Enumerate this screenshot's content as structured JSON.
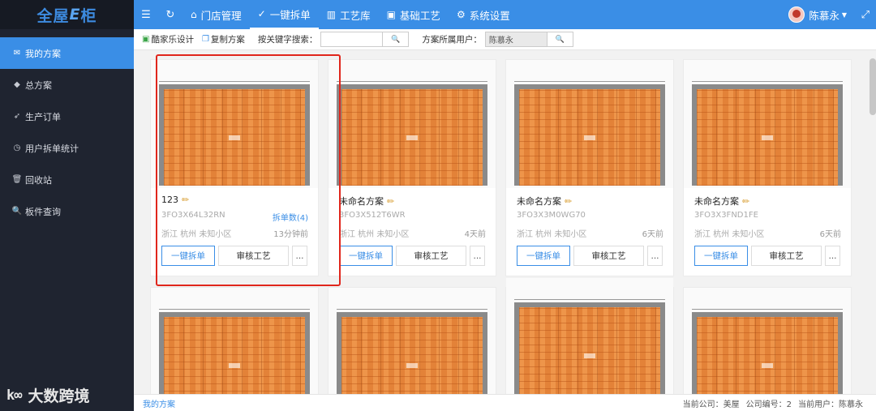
{
  "app": {
    "logo_main": "全屋",
    "logo_e": "E",
    "logo_tail": "柜"
  },
  "sidebar": {
    "items": [
      {
        "label": "我的方案",
        "icon": "✉",
        "active": true
      },
      {
        "label": "总方案",
        "icon": "◆",
        "active": false
      },
      {
        "label": "生产订单",
        "icon": "➶",
        "active": false
      },
      {
        "label": "用户拆单统计",
        "icon": "◷",
        "active": false
      },
      {
        "label": "回收站",
        "icon": "🗑",
        "active": false
      },
      {
        "label": "板件查询",
        "icon": "🔍",
        "active": false
      }
    ],
    "watermark": "大数跨境",
    "watermark_logo": "k∞"
  },
  "topbar": {
    "menu_icon": "☰",
    "refresh_icon": "↻",
    "nav": [
      {
        "label": "门店管理",
        "icon": "⌂"
      },
      {
        "label": "一键拆单",
        "icon": "✓"
      },
      {
        "label": "工艺库",
        "icon": "▥"
      },
      {
        "label": "基础工艺",
        "icon": "▣"
      },
      {
        "label": "系统设置",
        "icon": "⚙"
      }
    ],
    "user": "陈慕永",
    "expand_icon": "⤢"
  },
  "toolbar": {
    "kujiale_label": "酷家乐设计",
    "copy_label": "复制方案",
    "keyword_label": "按关键字搜索：",
    "keyword_value": "",
    "owner_label": "方案所属用户：",
    "owner_value": "陈慕永",
    "search_icon": "🔍"
  },
  "cards": [
    {
      "name": "123",
      "code": "3FO3X64L32RN",
      "split": "拆单数(4)",
      "location": "浙江 杭州 未知小区",
      "time": "13分钟前"
    },
    {
      "name": "未命名方案",
      "code": "3FO3X512T6WR",
      "split": "",
      "location": "浙江 杭州 未知小区",
      "time": "4天前"
    },
    {
      "name": "未命名方案",
      "code": "3FO3X3M0WG70",
      "split": "",
      "location": "浙江 杭州 未知小区",
      "time": "6天前"
    },
    {
      "name": "未命名方案",
      "code": "3FO3X3FND1FE",
      "split": "",
      "location": "浙江 杭州 未知小区",
      "time": "6天前"
    }
  ],
  "card_buttons": {
    "split": "一键拆单",
    "audit": "审核工艺",
    "more": "..."
  },
  "footer": {
    "crumb": "我的方案",
    "company": "当前公司：美屋",
    "company_no": "公司编号：2",
    "current_user": "当前用户：陈慕永"
  },
  "colors": {
    "accent": "#3a8ee6",
    "sidebar": "#1f2430",
    "highlight": "#e0261c"
  }
}
